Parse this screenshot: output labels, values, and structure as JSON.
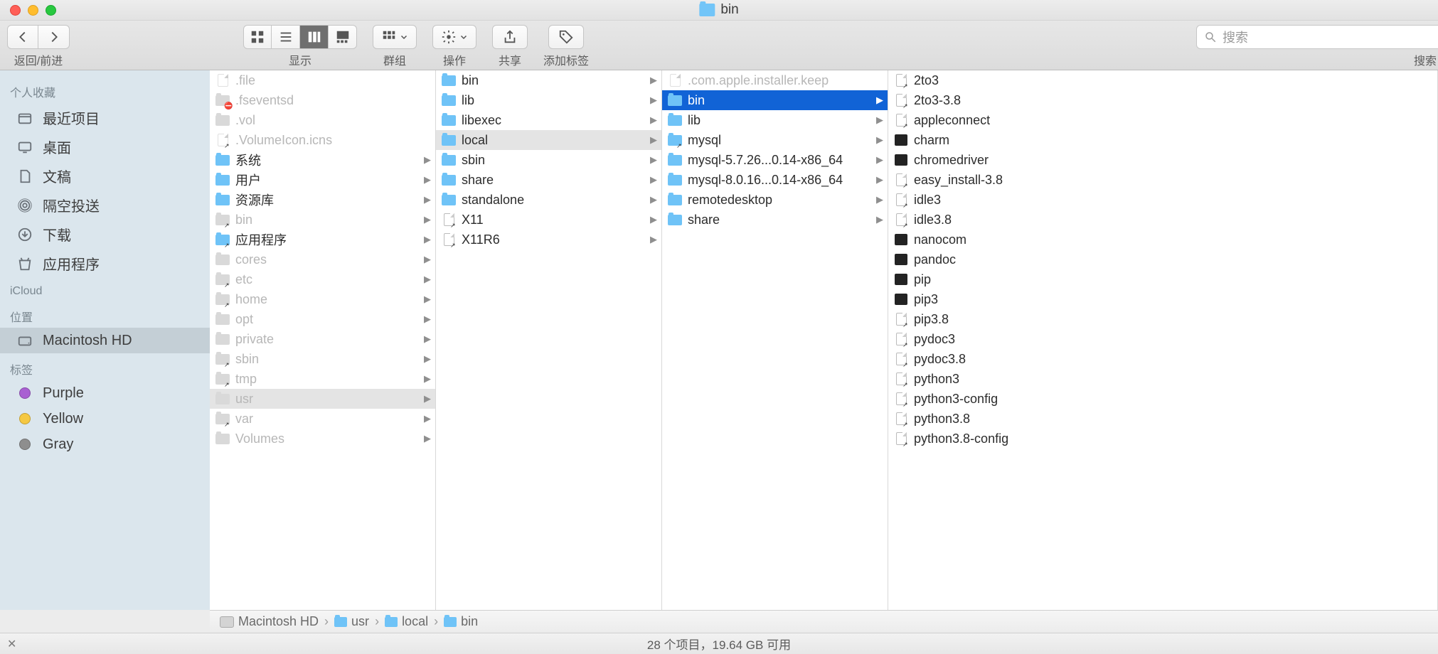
{
  "window": {
    "title": "bin"
  },
  "toolbar": {
    "nav_label": "返回/前进",
    "view_label": "显示",
    "group_label": "群组",
    "action_label": "操作",
    "share_label": "共享",
    "tags_label": "添加标签",
    "search_label": "搜索",
    "search_placeholder": "搜索"
  },
  "sidebar": {
    "sections": [
      {
        "header": "个人收藏",
        "items": [
          {
            "icon": "recent",
            "label": "最近项目"
          },
          {
            "icon": "desktop",
            "label": "桌面"
          },
          {
            "icon": "documents",
            "label": "文稿"
          },
          {
            "icon": "airdrop",
            "label": "隔空投送"
          },
          {
            "icon": "downloads",
            "label": "下载"
          },
          {
            "icon": "applications",
            "label": "应用程序"
          }
        ]
      },
      {
        "header": "iCloud",
        "items": []
      },
      {
        "header": "位置",
        "items": [
          {
            "icon": "disk",
            "label": "Macintosh HD",
            "selected": true
          }
        ]
      },
      {
        "header": "标签",
        "items": [
          {
            "icon": "tag",
            "color": "#a960d2",
            "label": "Purple"
          },
          {
            "icon": "tag",
            "color": "#f5c842",
            "label": "Yellow"
          },
          {
            "icon": "tag",
            "color": "#8e8e8e",
            "label": "Gray"
          }
        ]
      }
    ]
  },
  "columns": [
    [
      {
        "type": "file-dim",
        "label": ".file"
      },
      {
        "type": "folder-dim",
        "label": ".fseventsd",
        "badge": "⛔"
      },
      {
        "type": "folder-dim",
        "label": ".vol"
      },
      {
        "type": "file-dim",
        "label": ".VolumeIcon.icns",
        "alias": true
      },
      {
        "type": "folder",
        "label": "系统",
        "arrow": true
      },
      {
        "type": "folder",
        "label": "用户",
        "arrow": true
      },
      {
        "type": "folder",
        "label": "资源库",
        "arrow": true
      },
      {
        "type": "folder-dim",
        "label": "bin",
        "arrow": true,
        "alias": true
      },
      {
        "type": "folder",
        "label": "应用程序",
        "arrow": true,
        "alias": true
      },
      {
        "type": "folder-dim",
        "label": "cores",
        "arrow": true
      },
      {
        "type": "folder-dim",
        "label": "etc",
        "arrow": true,
        "alias": true
      },
      {
        "type": "folder-dim",
        "label": "home",
        "arrow": true,
        "alias": true
      },
      {
        "type": "folder-dim",
        "label": "opt",
        "arrow": true
      },
      {
        "type": "folder-dim",
        "label": "private",
        "arrow": true
      },
      {
        "type": "folder-dim",
        "label": "sbin",
        "arrow": true,
        "alias": true
      },
      {
        "type": "folder-dim",
        "label": "tmp",
        "arrow": true,
        "alias": true
      },
      {
        "type": "folder-dim",
        "label": "usr",
        "arrow": true,
        "selected": "path"
      },
      {
        "type": "folder-dim",
        "label": "var",
        "arrow": true,
        "alias": true
      },
      {
        "type": "folder-dim",
        "label": "Volumes",
        "arrow": true
      }
    ],
    [
      {
        "type": "folder",
        "label": "bin",
        "arrow": true
      },
      {
        "type": "folder",
        "label": "lib",
        "arrow": true
      },
      {
        "type": "folder",
        "label": "libexec",
        "arrow": true
      },
      {
        "type": "folder",
        "label": "local",
        "arrow": true,
        "selected": "path"
      },
      {
        "type": "folder",
        "label": "sbin",
        "arrow": true
      },
      {
        "type": "folder",
        "label": "share",
        "arrow": true
      },
      {
        "type": "folder",
        "label": "standalone",
        "arrow": true
      },
      {
        "type": "file",
        "label": "X11",
        "arrow": true,
        "alias": true
      },
      {
        "type": "file",
        "label": "X11R6",
        "arrow": true,
        "alias": true
      }
    ],
    [
      {
        "type": "file-dim",
        "label": ".com.apple.installer.keep"
      },
      {
        "type": "folder",
        "label": "bin",
        "arrow": true,
        "selected": "active"
      },
      {
        "type": "folder",
        "label": "lib",
        "arrow": true
      },
      {
        "type": "folder",
        "label": "mysql",
        "arrow": true,
        "alias": true
      },
      {
        "type": "folder",
        "label": "mysql-5.7.26...0.14-x86_64",
        "arrow": true
      },
      {
        "type": "folder",
        "label": "mysql-8.0.16...0.14-x86_64",
        "arrow": true
      },
      {
        "type": "folder",
        "label": "remotedesktop",
        "arrow": true
      },
      {
        "type": "folder",
        "label": "share",
        "arrow": true
      }
    ],
    [
      {
        "type": "file",
        "label": "2to3",
        "alias": true
      },
      {
        "type": "file",
        "label": "2to3-3.8",
        "alias": true
      },
      {
        "type": "file",
        "label": "appleconnect",
        "alias": true
      },
      {
        "type": "exec",
        "label": "charm"
      },
      {
        "type": "exec",
        "label": "chromedriver"
      },
      {
        "type": "file",
        "label": "easy_install-3.8",
        "alias": true
      },
      {
        "type": "file",
        "label": "idle3",
        "alias": true
      },
      {
        "type": "file",
        "label": "idle3.8",
        "alias": true
      },
      {
        "type": "exec",
        "label": "nanocom"
      },
      {
        "type": "exec",
        "label": "pandoc"
      },
      {
        "type": "exec",
        "label": "pip"
      },
      {
        "type": "exec",
        "label": "pip3"
      },
      {
        "type": "file",
        "label": "pip3.8",
        "alias": true
      },
      {
        "type": "file",
        "label": "pydoc3",
        "alias": true
      },
      {
        "type": "file",
        "label": "pydoc3.8",
        "alias": true
      },
      {
        "type": "file",
        "label": "python3",
        "alias": true
      },
      {
        "type": "file",
        "label": "python3-config",
        "alias": true
      },
      {
        "type": "file",
        "label": "python3.8",
        "alias": true
      },
      {
        "type": "file",
        "label": "python3.8-config",
        "alias": true
      }
    ]
  ],
  "pathbar": [
    {
      "icon": "disk",
      "label": "Macintosh HD"
    },
    {
      "icon": "folder",
      "label": "usr"
    },
    {
      "icon": "folder",
      "label": "local"
    },
    {
      "icon": "folder",
      "label": "bin"
    }
  ],
  "status": {
    "text": "28 个项目，19.64 GB 可用"
  }
}
